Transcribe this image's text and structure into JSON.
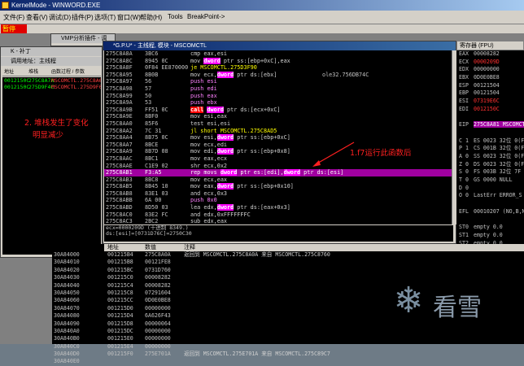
{
  "app": {
    "title": "KernelMode - WINWORD.EXE",
    "status": "暂停"
  },
  "menu": [
    "文件(F)",
    "查看(V)",
    "调试(D)",
    "插件(P)",
    "选项(T)",
    "窗口(W)",
    "帮助(H)",
    "Tools",
    "BreakPoint->"
  ],
  "vmp_title": "VMP分析插件 - 调",
  "callstack": {
    "title": "K - 补丁",
    "sub": "调用地址：主线程",
    "headers": [
      "地址",
      "堆栈",
      "函数过程 / 参数"
    ],
    "rows": [
      [
        "0012150C",
        "275C8A7A",
        "MSCOMCTL.275C8A68"
      ],
      [
        "0012150C",
        "275D9F4C",
        "MSCOMCTL.275D9F0C"
      ]
    ]
  },
  "cpu_title": "*G.P.U* - 主线程, 模块 - MSCOMCTL",
  "disasm": [
    [
      "275C8A8A",
      "3BC6",
      "cmp eax,esi",
      ""
    ],
    [
      "275C8A8C",
      "8945 0C",
      "mov dword ptr ss:[ebp+0xC],eax",
      ""
    ],
    [
      "275C8A8F",
      "0F84 EE870000",
      "je MSCOMCTL.275D3F90",
      ""
    ],
    [
      "275C8A95",
      "8B0B",
      "mov ecx,dword ptr ds:[ebx]",
      "ole32.756DB74C"
    ],
    [
      "275C8A97",
      "56",
      "push esi",
      ""
    ],
    [
      "275C8A98",
      "57",
      "push edi",
      ""
    ],
    [
      "275C8A99",
      "50",
      "push eax",
      ""
    ],
    [
      "275C8A9A",
      "53",
      "push ebx",
      ""
    ],
    [
      "275C8A9B",
      "FF51 0C",
      "call dword ptr ds:[ecx+0xC]",
      ""
    ],
    [
      "275C8A9E",
      "8BF0",
      "mov esi,eax",
      ""
    ],
    [
      "275C8AA0",
      "85F6",
      "test esi,esi",
      ""
    ],
    [
      "275C8AA2",
      "7C 31",
      "jl short MSCOMCTL.275C8AD5",
      ""
    ],
    [
      "275C8AA4",
      "8B75 0C",
      "mov esi,dword ptr ss:[ebp+0xC]",
      ""
    ],
    [
      "275C8AA7",
      "8BCE",
      "mov ecx,edi",
      ""
    ],
    [
      "275C8AA9",
      "8B7D 08",
      "mov edi,dword ptr ss:[ebp+0x8]",
      ""
    ],
    [
      "275C8AAC",
      "8BC1",
      "mov eax,ecx",
      ""
    ],
    [
      "275C8AAE",
      "C1E9 02",
      "shr ecx,0x2",
      ""
    ],
    [
      "275C8AB1",
      "F3:A5",
      "rep movs dword ptr es:[edi],dword ptr ds:[esi]",
      ""
    ],
    [
      "275C8AB3",
      "8BC8",
      "mov ecx,eax",
      ""
    ],
    [
      "275C8AB5",
      "8B45 10",
      "mov eax,dword ptr ss:[ebp+0x10]",
      ""
    ],
    [
      "275C8AB8",
      "83E1 03",
      "and ecx,0x3",
      ""
    ],
    [
      "275C8ABB",
      "6A 00",
      "push 0x0",
      ""
    ],
    [
      "275C8ABD",
      "8D50 03",
      "lea edx,dword ptr ds:[eax+0x3]",
      ""
    ],
    [
      "275C8AC0",
      "83E2 FC",
      "and edx,0xFFFFFFFC",
      ""
    ],
    [
      "275C8AC3",
      "2BC2",
      "sub edx,eax",
      ""
    ],
    [
      "275C8AC5",
      "F3:A4",
      "rep movs byte ptr es:[edi],byte ptr ds:",
      ""
    ],
    [
      "275C8AC7",
      "8B0B",
      "mov ecx,dword ptr ds:[ebx]",
      "ole32.756DB74C"
    ]
  ],
  "info": [
    "ecx=0000209D (十进制 8349.)",
    "ds:[esi]=[0731D76C]=2750C30",
    "es:[edi]=[0012150C]=ole32.756B7B16"
  ],
  "regs_title": "寄存器 (FPU)",
  "regs": [
    [
      "EAX",
      "00008282",
      false
    ],
    [
      "ECX",
      "0000209D",
      true
    ],
    [
      "EDX",
      "00000000",
      false
    ],
    [
      "EBX",
      "0D0E0BE8",
      false
    ],
    [
      "ESP",
      "00121504",
      false
    ],
    [
      "EBP",
      "00121504",
      false
    ],
    [
      "ESI",
      "07319E6C",
      true
    ],
    [
      "EDI",
      "0012150C",
      true
    ],
    [
      "",
      ""
    ],
    [
      "EIP",
      "275C8A81 MSCOMCTL",
      false
    ],
    [
      "",
      ""
    ],
    [
      "C 1",
      "ES 0023 32位 0(F",
      false
    ],
    [
      "P 1",
      "CS 001B 32位 0(F",
      false
    ],
    [
      "A 0",
      "SS 0023 32位 0(F",
      false
    ],
    [
      "Z 0",
      "DS 0023 32位 0(F",
      false
    ],
    [
      "S 0",
      "FS 003B 32位 7F",
      false
    ],
    [
      "T 0",
      "GS 0000 NULL",
      false
    ],
    [
      "D 0",
      ""
    ],
    [
      "O 0",
      "LastErr ERROR_S",
      false
    ],
    [
      "",
      ""
    ],
    [
      "EFL",
      "00010207 (NO,B,N",
      false
    ],
    [
      "",
      ""
    ],
    [
      "ST0",
      "empty 0.0",
      false
    ],
    [
      "ST1",
      "empty 0.0",
      false
    ],
    [
      "ST2",
      "empty 0.0",
      false
    ],
    [
      "ST3",
      "empty 0.0",
      false
    ],
    [
      "ST4",
      "empty 0.0",
      false
    ],
    [
      "ST5",
      "empty 0.0",
      false
    ],
    [
      "ST6",
      "empty 1.0000000",
      false
    ],
    [
      "ST7",
      "empty 0.0",
      false
    ]
  ],
  "dump": [
    "30A84000",
    "30A84010",
    "30A84020",
    "30A84030",
    "30A84040",
    "30A84050",
    "30A84060",
    "30A84070",
    "30A84080",
    "30A84090",
    "30A840A0",
    "30A840B0",
    "30A840C0",
    "30A840D0",
    "30A840E0"
  ],
  "stack_headers": [
    "地址",
    "数值",
    "注释"
  ],
  "stack": [
    [
      "001215B4",
      "275C8A0A",
      "返回到 MSCOMCTL.275C8A0A 来自 MSCOMCTL.275C8760"
    ],
    [
      "001215B8",
      "00121FE8",
      ""
    ],
    [
      "001215BC",
      "0731D760",
      ""
    ],
    [
      "001215C0",
      "00008282",
      ""
    ],
    [
      "001215C4",
      "00008282",
      ""
    ],
    [
      "001215C8",
      "07291604",
      ""
    ],
    [
      "001215CC",
      "0D0E0BE8",
      ""
    ],
    [
      "001215D0",
      "00000000",
      ""
    ],
    [
      "001215D4",
      "6A626F43",
      ""
    ],
    [
      "001215D8",
      "00000064",
      ""
    ],
    [
      "001215DC",
      "00000000",
      ""
    ],
    [
      "001215E0",
      "00000000",
      ""
    ],
    [
      "001215E4",
      "00000000",
      ""
    ],
    [
      "001215F0",
      "275E701A",
      "返回到 MSCOMCTL.275E701A 来自 MSCOMCTL.275C89C7"
    ]
  ],
  "ann1": "1.f7运行此函数后",
  "ann2a": "2. 堆栈发生了变化",
  "ann2b": "明显减少",
  "watermark": "看雪"
}
